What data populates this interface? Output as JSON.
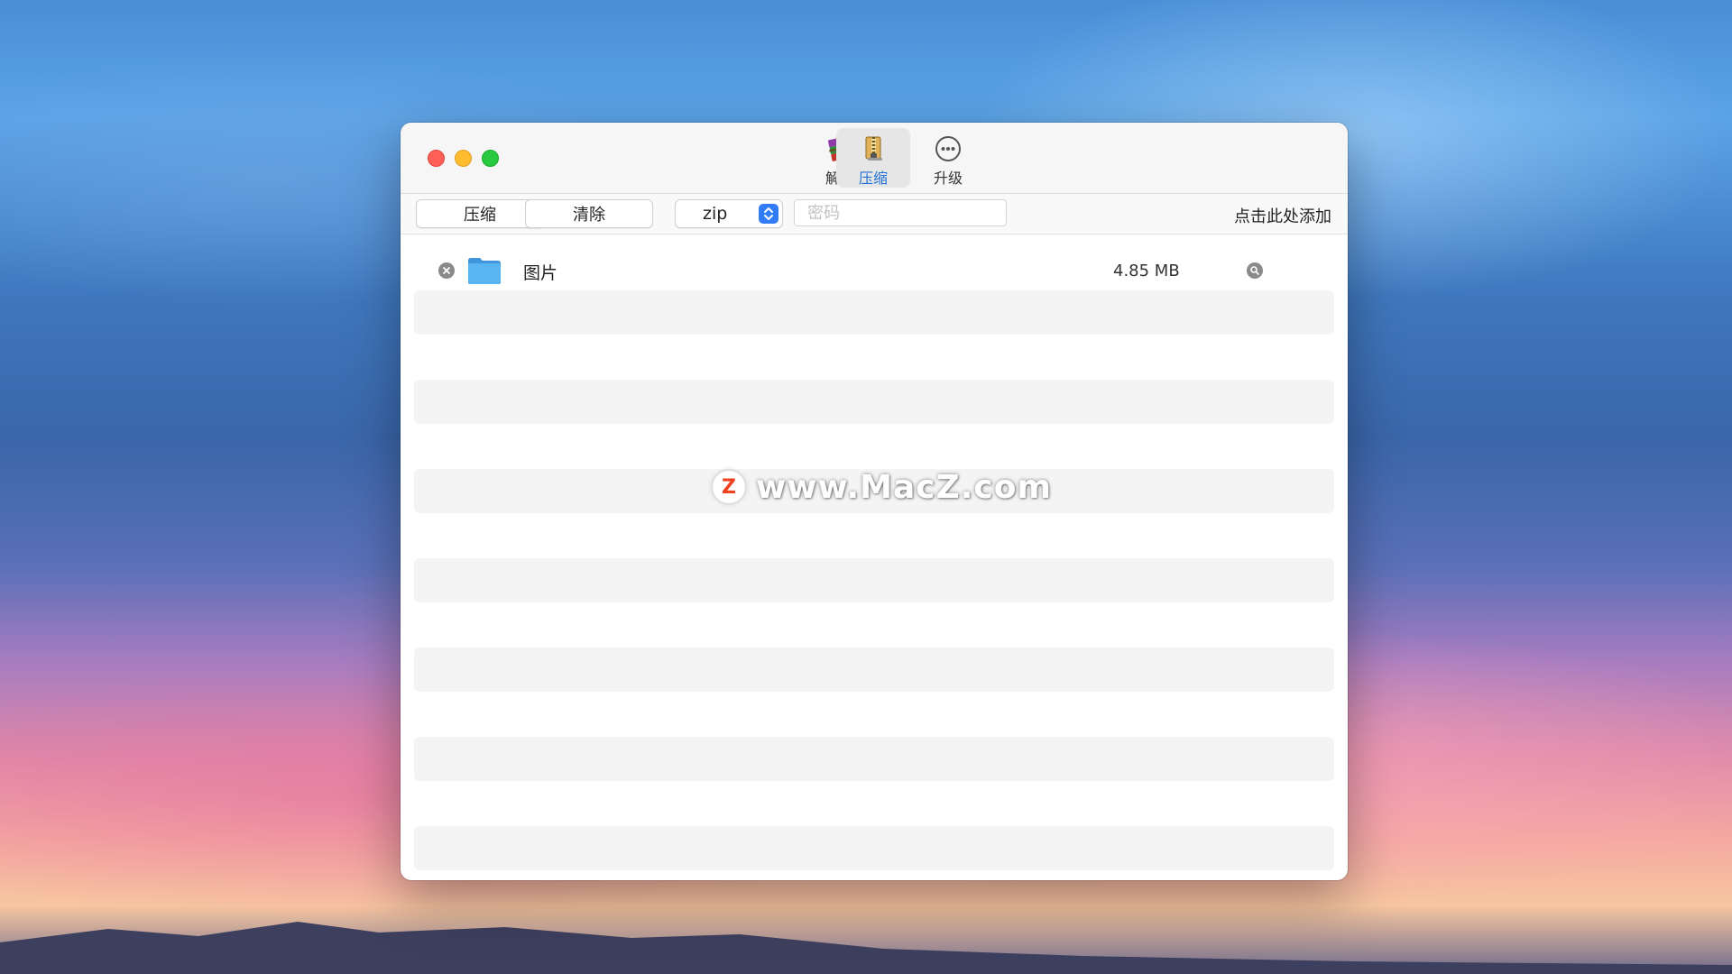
{
  "toolbar_tabs": [
    {
      "label": "解压",
      "icon": "winrar-books-icon",
      "active": false
    },
    {
      "label": "压缩",
      "icon": "zip-archive-icon",
      "active": true
    },
    {
      "label": "升级",
      "icon": "more-circle-icon",
      "active": false
    }
  ],
  "actions": {
    "compress_label": "压缩",
    "clear_label": "清除",
    "format_value": "zip",
    "password_placeholder": "密码",
    "add_hint": "点击此处添加"
  },
  "files": [
    {
      "name": "图片",
      "size": "4.85 MB",
      "icon": "folder-icon"
    }
  ],
  "watermark": {
    "logo": "Z",
    "text": "www.MacZ.com"
  },
  "colors": {
    "accent": "#1f6fd6",
    "stepper": "#2f7cf6",
    "close": "#fe5f57",
    "minimize": "#febc2e",
    "maximize": "#28c840",
    "stripe": "#f4f4f4",
    "folder": "#5ab4f0"
  }
}
